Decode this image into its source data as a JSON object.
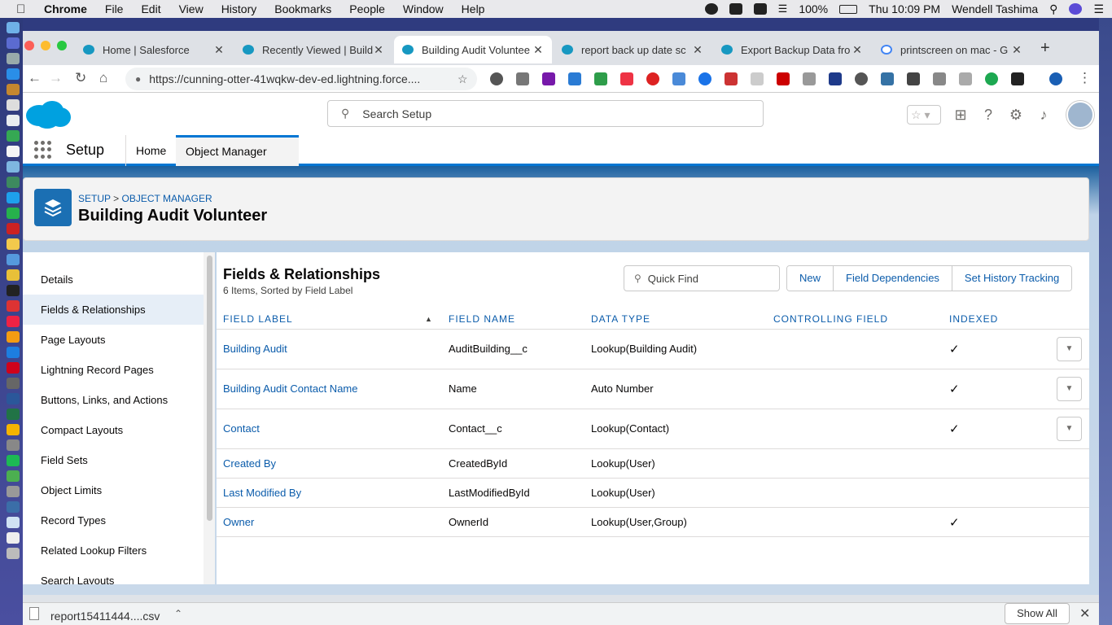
{
  "menubar": {
    "app": "Chrome",
    "items": [
      "File",
      "Edit",
      "View",
      "History",
      "Bookmarks",
      "People",
      "Window",
      "Help"
    ],
    "battery": "100%",
    "clock": "Thu 10:09 PM",
    "user": "Wendell Tashima"
  },
  "tabs": [
    {
      "title": "Home | Salesforce"
    },
    {
      "title": "Recently Viewed | Build"
    },
    {
      "title": "Building Audit Voluntee"
    },
    {
      "title": "report back up date sc"
    },
    {
      "title": "Export Backup Data fro"
    },
    {
      "title": "printscreen on mac - G"
    }
  ],
  "omnibox": {
    "url": "https://cunning-otter-41wqkw-dev-ed.lightning.force...."
  },
  "header": {
    "search_placeholder": "Search Setup"
  },
  "nav": {
    "app_name": "Setup",
    "home": "Home",
    "object_manager": "Object Manager"
  },
  "page": {
    "breadcrumb_setup": "SETUP",
    "breadcrumb_sep": ">",
    "breadcrumb_om": "OBJECT MANAGER",
    "title": "Building Audit Volunteer"
  },
  "leftmenu": [
    {
      "label": "Details"
    },
    {
      "label": "Fields & Relationships"
    },
    {
      "label": "Page Layouts"
    },
    {
      "label": "Lightning Record Pages"
    },
    {
      "label": "Buttons, Links, and Actions"
    },
    {
      "label": "Compact Layouts"
    },
    {
      "label": "Field Sets"
    },
    {
      "label": "Object Limits"
    },
    {
      "label": "Record Types"
    },
    {
      "label": "Related Lookup Filters"
    },
    {
      "label": "Search Layouts"
    }
  ],
  "main": {
    "title": "Fields & Relationships",
    "subtitle": "6 Items, Sorted by Field Label",
    "quick_find_placeholder": "Quick Find",
    "buttons": {
      "new": "New",
      "field_dependencies": "Field Dependencies",
      "history": "Set History Tracking"
    },
    "columns": {
      "label": "FIELD LABEL",
      "name": "FIELD NAME",
      "type": "DATA TYPE",
      "controlling": "CONTROLLING FIELD",
      "indexed": "INDEXED"
    },
    "rows": [
      {
        "label": "Building Audit",
        "name": "AuditBuilding__c",
        "type": "Lookup(Building Audit)",
        "controlling": "",
        "indexed": "✓"
      },
      {
        "label": "Building Audit Contact Name",
        "name": "Name",
        "type": "Auto Number",
        "controlling": "",
        "indexed": "✓"
      },
      {
        "label": "Contact",
        "name": "Contact__c",
        "type": "Lookup(Contact)",
        "controlling": "",
        "indexed": "✓"
      },
      {
        "label": "Created By",
        "name": "CreatedById",
        "type": "Lookup(User)",
        "controlling": "",
        "indexed": ""
      },
      {
        "label": "Last Modified By",
        "name": "LastModifiedById",
        "type": "Lookup(User)",
        "controlling": "",
        "indexed": ""
      },
      {
        "label": "Owner",
        "name": "OwnerId",
        "type": "Lookup(User,Group)",
        "controlling": "",
        "indexed": "✓"
      }
    ]
  },
  "downloads": {
    "file": "report15411444....csv",
    "show_all": "Show All"
  }
}
